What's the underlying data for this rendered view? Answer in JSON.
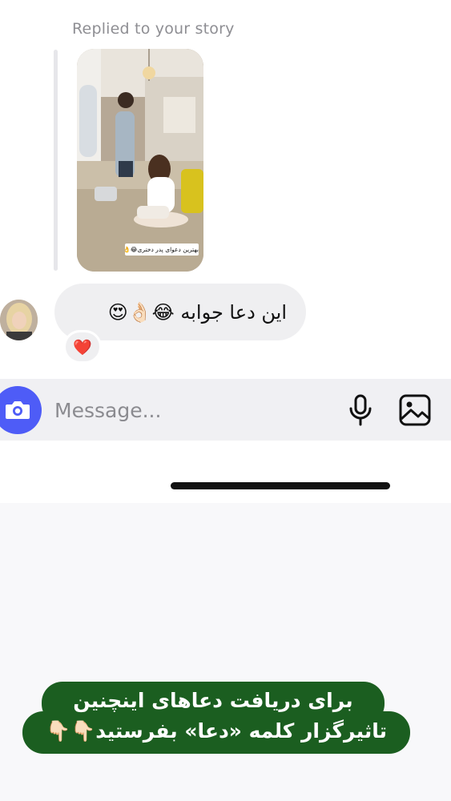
{
  "conversation": {
    "reply_label": "Replied to your story",
    "story_caption": "بهترین دعوای پدر دختری😂👌",
    "message": {
      "text": "این دعا جوابه 😂👌🏻😍",
      "reaction": "❤️"
    }
  },
  "composer": {
    "placeholder": "Message...",
    "camera_icon": "camera-icon",
    "mic_icon": "microphone-icon",
    "gallery_icon": "gallery-icon"
  },
  "banner": {
    "line1": "برای دریافت دعاهای اینچنین",
    "line2": "تاثیرگزار کلمه «دعا» بفرستید👇🏻👇🏻"
  },
  "colors": {
    "camera_button": "#4e5cf7",
    "bubble": "#efeff1",
    "banner": "#1b5e20",
    "reaction_heart": "#ee1d3c"
  }
}
